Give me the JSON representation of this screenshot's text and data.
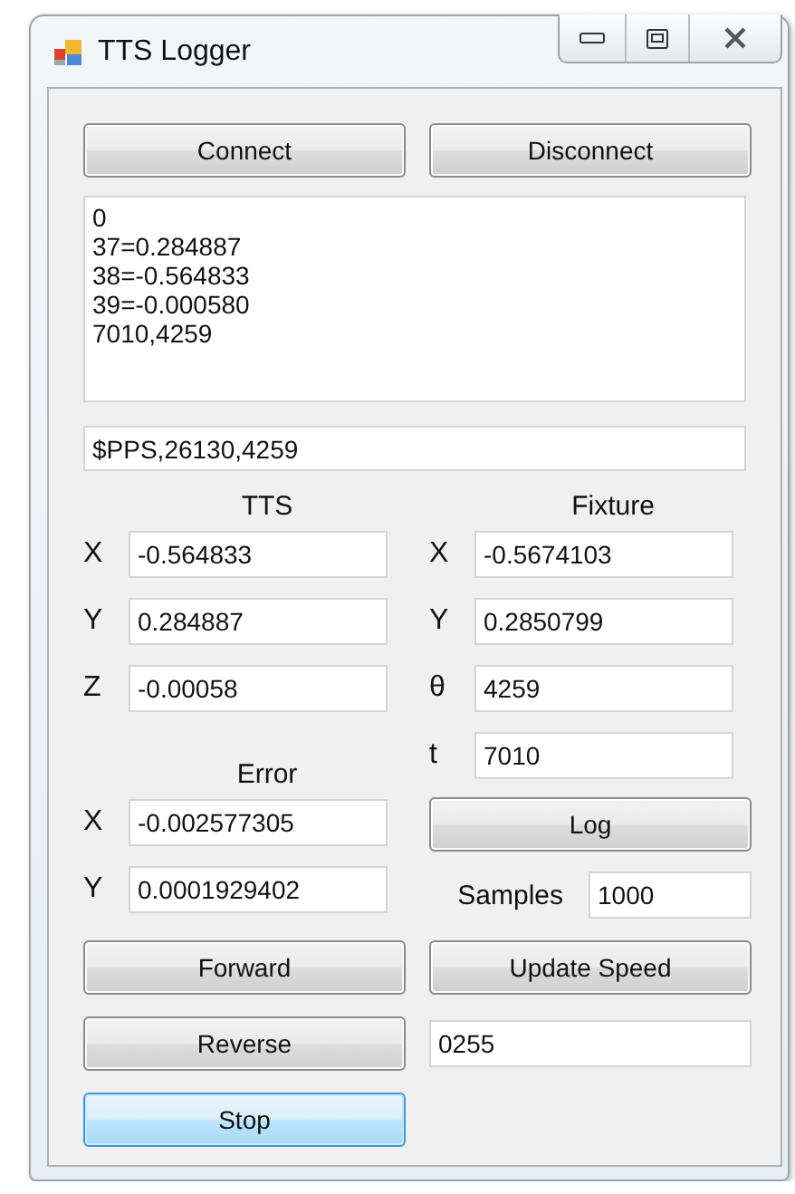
{
  "window": {
    "title": "TTS Logger"
  },
  "connect_button": {
    "label": "Connect",
    "focused": false
  },
  "disconnect_button": {
    "label": "Disconnect",
    "focused": false
  },
  "log": {
    "lines": [
      "0",
      "37=0.284887",
      "38=-0.564833",
      "39=-0.000580",
      "7010,4259"
    ]
  },
  "sentence_field": {
    "value": "$PPS,26130,4259"
  },
  "tts": {
    "heading": "TTS",
    "fields": [
      {
        "label": "X",
        "value": "-0.564833"
      },
      {
        "label": "Y",
        "value": "0.284887"
      },
      {
        "label": "Z",
        "value": "-0.00058"
      }
    ]
  },
  "fixture": {
    "heading": "Fixture",
    "fields": [
      {
        "label": "X",
        "value": "-0.5674103"
      },
      {
        "label": "Y",
        "value": "0.2850799"
      },
      {
        "label": "θ",
        "value": "4259"
      },
      {
        "label": "t",
        "value": "7010"
      }
    ]
  },
  "error": {
    "heading": "Error",
    "fields": [
      {
        "label": "X",
        "value": "-0.002577305"
      },
      {
        "label": "Y",
        "value": "0.0001929402"
      }
    ]
  },
  "log_button": {
    "label": "Log",
    "focused": false
  },
  "samples": {
    "label": "Samples",
    "value": "1000"
  },
  "forward_button": {
    "label": "Forward",
    "focused": false
  },
  "update_speed_button": {
    "label": "Update Speed",
    "focused": false
  },
  "reverse_button": {
    "label": "Reverse",
    "focused": false
  },
  "speed_field": {
    "value": "0255"
  },
  "stop_button": {
    "label": "Stop",
    "focused": true
  }
}
